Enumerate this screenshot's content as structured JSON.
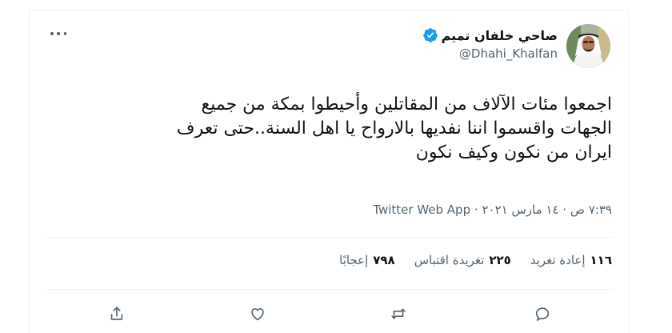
{
  "tweet": {
    "author_name": "ضاحي خلفان تميم",
    "handle": "@Dhahi_Khalfan",
    "verified_icon": "verified-badge-icon",
    "more_icon": "more-options-icon",
    "text": "اجمعوا مئات الآلاف من المقاتلين وأحيطوا بمكة من جميع\nالجهات واقسموا اننا نفديها بالارواح يا اهل السنة..حتى تعرف\nايران من نكون وكيف نكون",
    "time": "٧:٣٩ ص",
    "date": "١٤ مارس ٢٠٢١",
    "source": "Twitter Web App",
    "separator": "·"
  },
  "stats": {
    "retweets_count": "١١٦",
    "retweets_label": "إعادة تغريد",
    "quotes_count": "٢٢٥",
    "quotes_label": "تغريدة اقتباس",
    "likes_count": "٧٩٨",
    "likes_label": "إعجابًا"
  },
  "actions": {
    "reply_icon": "reply-icon",
    "retweet_icon": "retweet-icon",
    "like_icon": "like-icon",
    "share_icon": "share-icon"
  },
  "colors": {
    "text_primary": "#0f1419",
    "text_secondary": "#536471",
    "verified_blue": "#1d9bf0",
    "border": "#eff3f4"
  }
}
